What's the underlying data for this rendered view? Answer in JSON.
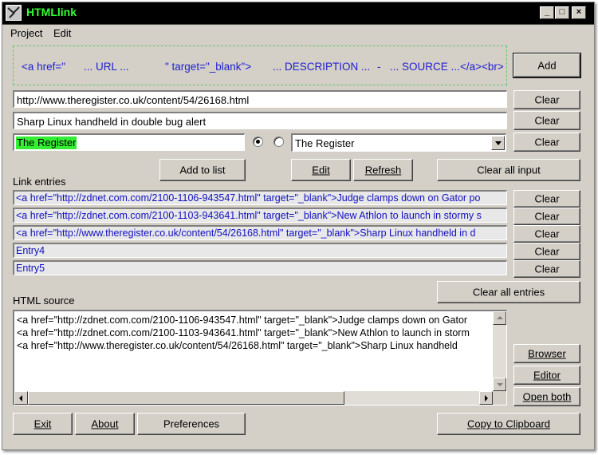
{
  "window": {
    "title": "HTMLlink"
  },
  "titlebar_buttons": {
    "minimize": "_",
    "maximize": "□",
    "close": "×"
  },
  "menu": {
    "project": "Project",
    "edit": "Edit"
  },
  "template": {
    "part1": "<a href=\"",
    "part2": "... URL ...",
    "part3": "\" target=\"_blank\">",
    "part4": "... DESCRIPTION ...",
    "part5": "-",
    "part6": "... SOURCE ...",
    "part7": "</a><br>"
  },
  "buttons": {
    "add": "Add",
    "clear": "Clear",
    "add_to_list": "Add to list",
    "edit": "Edit",
    "refresh": "Refresh",
    "clear_all_input": "Clear all input",
    "clear_all_entries": "Clear all entries",
    "browser": "Browser",
    "editor": "Editor",
    "open_both": "Open both",
    "exit": "Exit",
    "about": "About",
    "preferences": "Preferences",
    "copy_to_clipboard": "Copy to Clipboard"
  },
  "inputs": {
    "url": "http://www.theregister.co.uk/content/54/26168.html",
    "description": "Sharp Linux handheld in double bug alert",
    "source_text": "The Register",
    "source_combo": "The Register"
  },
  "labels": {
    "link_entries": "Link entries",
    "html_source": "HTML source"
  },
  "entries": [
    "<a href=\"http://zdnet.com.com/2100-1106-943547.html\" target=\"_blank\">Judge clamps down on Gator po",
    "<a href=\"http://zdnet.com.com/2100-1103-943641.html\" target=\"_blank\">New Athlon to launch in stormy s",
    "<a href=\"http://www.theregister.co.uk/content/54/26168.html\" target=\"_blank\">Sharp Linux handheld in d",
    "Entry4",
    "Entry5"
  ],
  "html_source_lines": [
    "<a href=\"http://zdnet.com.com/2100-1106-943547.html\" target=\"_blank\">Judge clamps down on Gator",
    "<a href=\"http://zdnet.com.com/2100-1103-943641.html\" target=\"_blank\">New Athlon to launch in storm",
    "<a href=\"http://www.theregister.co.uk/content/54/26168.html\" target=\"_blank\">Sharp Linux handheld"
  ],
  "colors": {
    "title_text": "#33ff33",
    "template_text": "#2020d0",
    "entry_text": "#1010c0",
    "source_highlight": "#33ee33"
  }
}
